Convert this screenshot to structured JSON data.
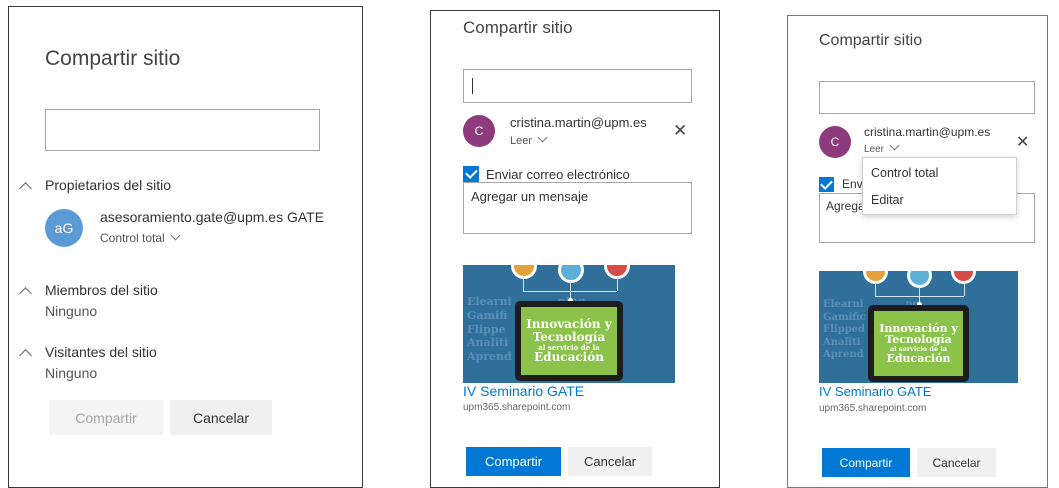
{
  "panel1": {
    "title": "Compartir sitio",
    "search_value": "",
    "sections": [
      {
        "title": "Propietarios del sitio"
      },
      {
        "title": "Miembros del sitio",
        "value": "Ninguno"
      },
      {
        "title": "Visitantes del sitio",
        "value": "Ninguno"
      }
    ],
    "owner": {
      "initials": "aG",
      "name": "asesoramiento.gate@upm.es GATE",
      "permission": "Control total",
      "avatar_color": "#5b9bd5"
    },
    "share_label": "Compartir",
    "cancel_label": "Cancelar"
  },
  "panel2": {
    "title": "Compartir sitio",
    "input_value": "",
    "user": {
      "initial": "C",
      "email": "cristina.martin@upm.es",
      "permission": "Leer",
      "avatar_color": "#8e3b7e"
    },
    "send_email_label": "Enviar correo electrónico",
    "send_email_checked": true,
    "message_placeholder": "Agregar un mensaje",
    "preview": {
      "title": "IV Seminario GATE",
      "url": "upm365.sharepoint.com",
      "image_text": {
        "line1": "Innovación y",
        "line2": "Tecnología",
        "line3": "al servicio de la",
        "line4": "Educación"
      }
    },
    "share_label": "Compartir",
    "cancel_label": "Cancelar",
    "accent": "#0078d4"
  },
  "panel3": {
    "title": "Compartir sitio",
    "input_value": "",
    "user": {
      "initial": "C",
      "email": "cristina.martin@upm.es",
      "permission": "Leer",
      "avatar_color": "#8e3b7e"
    },
    "send_email_label": "Envi",
    "message_placeholder": "Agrega",
    "dropdown_options": [
      "Control total",
      "Editar"
    ],
    "preview": {
      "title": "IV Seminario GATE",
      "url": "upm365.sharepoint.com",
      "image_text": {
        "line1": "Innovación y",
        "line2": "Tecnología",
        "line3": "al servicio de la",
        "line4": "Educación"
      }
    },
    "share_label": "Compartir",
    "cancel_label": "Cancelar"
  }
}
